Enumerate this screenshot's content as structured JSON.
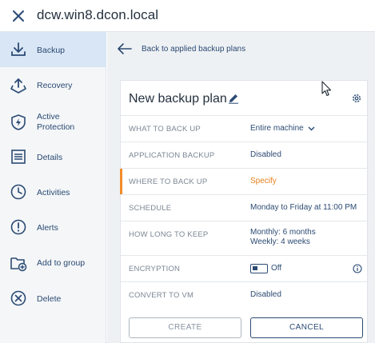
{
  "header": {
    "title": "dcw.win8.dcon.local"
  },
  "sidebar": {
    "items": [
      {
        "label": "Backup",
        "icon": "backup-icon"
      },
      {
        "label": "Recovery",
        "icon": "recovery-icon"
      },
      {
        "label": "Active Protection",
        "icon": "shield-icon"
      },
      {
        "label": "Details",
        "icon": "details-icon"
      },
      {
        "label": "Activities",
        "icon": "clock-icon"
      },
      {
        "label": "Alerts",
        "icon": "alert-icon"
      },
      {
        "label": "Add to group",
        "icon": "add-to-group-icon"
      },
      {
        "label": "Delete",
        "icon": "delete-icon"
      }
    ]
  },
  "main": {
    "back_label": "Back to applied backup plans",
    "plan": {
      "title": "New backup plan",
      "rows": [
        {
          "label": "WHAT TO BACK UP",
          "value": "Entire machine"
        },
        {
          "label": "APPLICATION BACKUP",
          "value": "Disabled"
        },
        {
          "label": "WHERE TO BACK UP",
          "value": "Specify"
        },
        {
          "label": "SCHEDULE",
          "value": "Monday to Friday at 11:00 PM"
        },
        {
          "label": "HOW LONG TO KEEP",
          "value_line1": "Monthly: 6 months",
          "value_line2": "Weekly: 4 weeks"
        },
        {
          "label": "ENCRYPTION",
          "value": "Off"
        },
        {
          "label": "CONVERT TO VM",
          "value": "Disabled"
        }
      ],
      "create_label": "CREATE",
      "cancel_label": "CANCEL"
    }
  },
  "colors": {
    "accent": "#2b4a73",
    "highlight": "#f28b2a",
    "active_bg": "#d8e6f5"
  }
}
